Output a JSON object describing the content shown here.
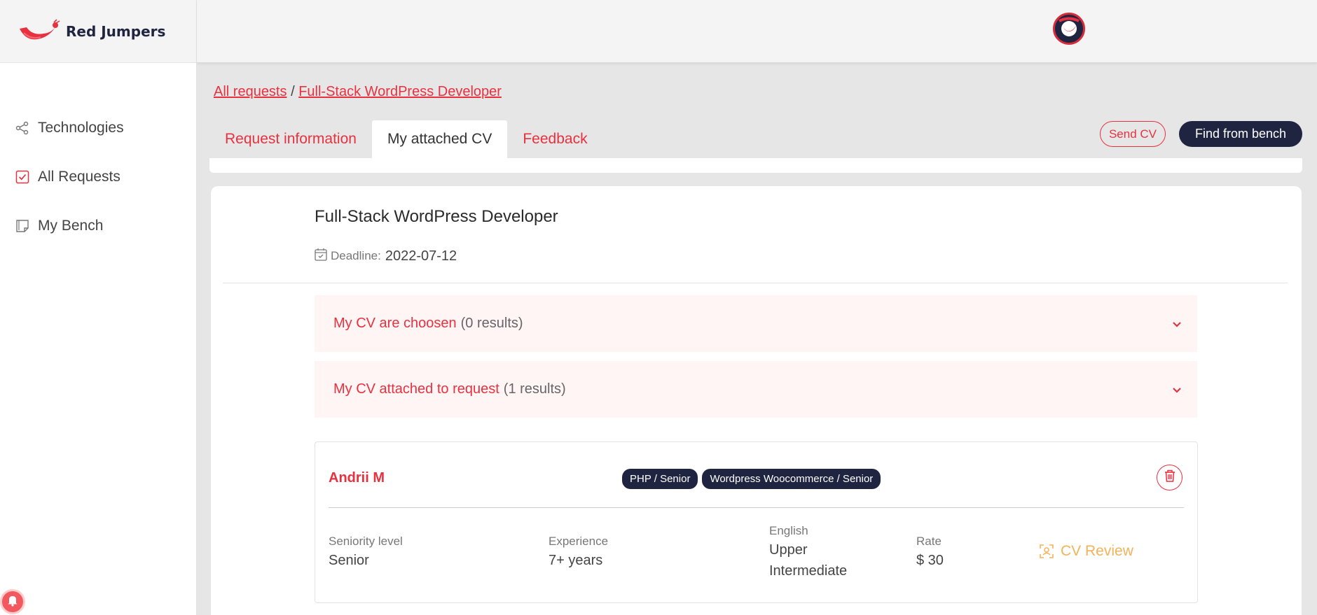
{
  "brand": {
    "name": "Red Jumpers",
    "accent": "#e8313f",
    "navy": "#1f2440",
    "review_color": "#f4b25b"
  },
  "sidebar": {
    "items": [
      {
        "label": "Technologies",
        "icon": "share-icon"
      },
      {
        "label": "All Requests",
        "icon": "checkbox-icon"
      },
      {
        "label": "My Bench",
        "icon": "note-icon"
      }
    ]
  },
  "breadcrumb": {
    "root": "All requests",
    "separator": "/",
    "current": "Full-Stack WordPress Developer"
  },
  "tabs": [
    {
      "label": "Request information",
      "active": false
    },
    {
      "label": "My attached CV",
      "active": true
    },
    {
      "label": "Feedback",
      "active": false
    }
  ],
  "actions": {
    "send_cv": "Send CV",
    "find_bench": "Find from bench"
  },
  "request": {
    "title": "Full-Stack WordPress Developer",
    "deadline_label": "Deadline:",
    "deadline": "2022-07-12"
  },
  "accordions": [
    {
      "title": "My CV are choosen",
      "count": "(0 results)"
    },
    {
      "title": "My CV attached to request",
      "count": "(1 results)"
    }
  ],
  "cv": {
    "name": "Andrii M",
    "tags": [
      "PHP / Senior",
      "Wordpress Woocommerce / Senior"
    ],
    "seniority_label": "Seniority level",
    "seniority": "Senior",
    "experience_label": "Experience",
    "experience": "7+ years",
    "english_label": "English",
    "english_line1": "Upper",
    "english_line2": "Intermediate",
    "rate_label": "Rate",
    "rate": "$ 30",
    "review_label": "CV Review"
  }
}
